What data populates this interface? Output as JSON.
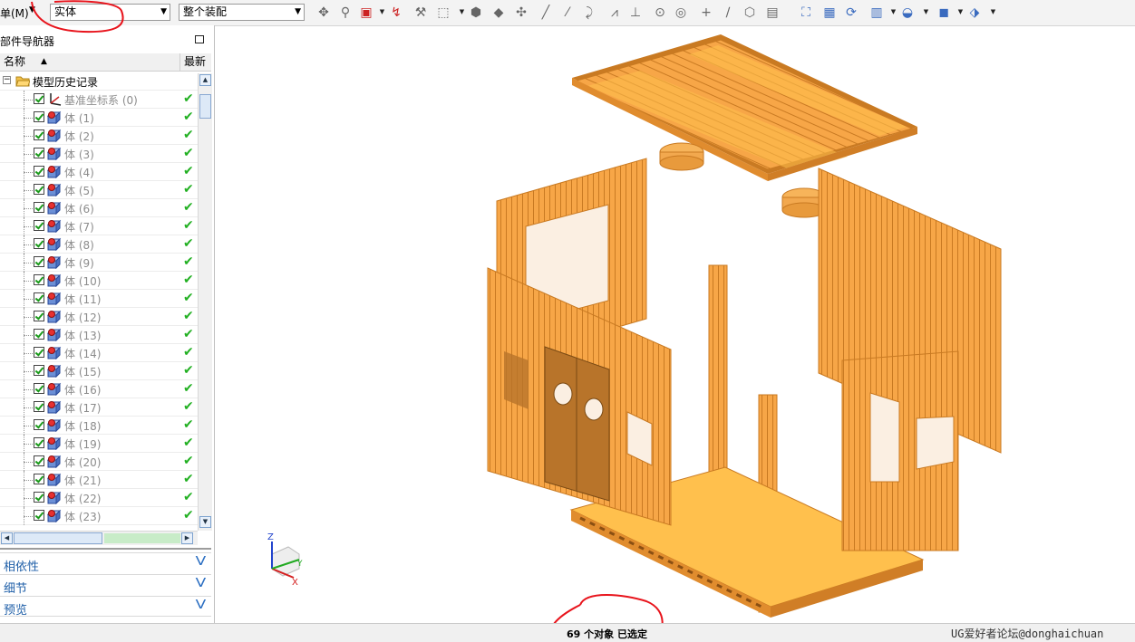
{
  "toolbar": {
    "menu_label": "单(M)",
    "filter_value": "实体",
    "scope_value": "整个装配",
    "icons": [
      "snap-point-icon",
      "pick-icon",
      "select-add-icon",
      "lasso-icon",
      "cursor-select-icon",
      "box-select-icon",
      "solid-view-icon",
      "shaded-box-icon",
      "node-icon",
      "line-icon",
      "line2-icon",
      "curve-icon",
      "polyline-icon",
      "axis-icon",
      "circle-icon",
      "circle-target-icon",
      "plus-icon",
      "slash-icon",
      "model-icon",
      "layer-icon",
      "fit-view-icon",
      "image-icon",
      "refresh-icon",
      "grid-view-icon",
      "render-style-icon",
      "cube-icon",
      "orient-icon"
    ]
  },
  "navigator": {
    "title": "部件导航器",
    "col_name": "名称",
    "col_latest": "最新",
    "root_label": "模型历史记录",
    "rows": [
      {
        "label": "基准坐标系 (0)",
        "type": "csys"
      },
      {
        "label": "体 (1)",
        "type": "body"
      },
      {
        "label": "体 (2)",
        "type": "body"
      },
      {
        "label": "体 (3)",
        "type": "body"
      },
      {
        "label": "体 (4)",
        "type": "body"
      },
      {
        "label": "体 (5)",
        "type": "body"
      },
      {
        "label": "体 (6)",
        "type": "body"
      },
      {
        "label": "体 (7)",
        "type": "body"
      },
      {
        "label": "体 (8)",
        "type": "body"
      },
      {
        "label": "体 (9)",
        "type": "body"
      },
      {
        "label": "体 (10)",
        "type": "body"
      },
      {
        "label": "体 (11)",
        "type": "body"
      },
      {
        "label": "体 (12)",
        "type": "body"
      },
      {
        "label": "体 (13)",
        "type": "body"
      },
      {
        "label": "体 (14)",
        "type": "body"
      },
      {
        "label": "体 (15)",
        "type": "body"
      },
      {
        "label": "体 (16)",
        "type": "body"
      },
      {
        "label": "体 (17)",
        "type": "body"
      },
      {
        "label": "体 (18)",
        "type": "body"
      },
      {
        "label": "体 (19)",
        "type": "body"
      },
      {
        "label": "体 (20)",
        "type": "body"
      },
      {
        "label": "体 (21)",
        "type": "body"
      },
      {
        "label": "体 (22)",
        "type": "body"
      },
      {
        "label": "体 (23)",
        "type": "body"
      }
    ],
    "sections": [
      "相依性",
      "细节",
      "预览"
    ]
  },
  "viewport": {
    "triad": {
      "z": "Z",
      "y": "Y",
      "x": "X"
    }
  },
  "status": {
    "selection_text": "69 个对象 已选定",
    "watermark": "UG爱好者论坛@donghaichuan"
  },
  "colors": {
    "model_orange": "#f7a647",
    "model_dark": "#c97a22",
    "model_light": "#ffd080",
    "door": "#b8742a",
    "window": "#fbefe2",
    "annotation_red": "#e8141c",
    "link_blue": "#1f5fa8"
  }
}
